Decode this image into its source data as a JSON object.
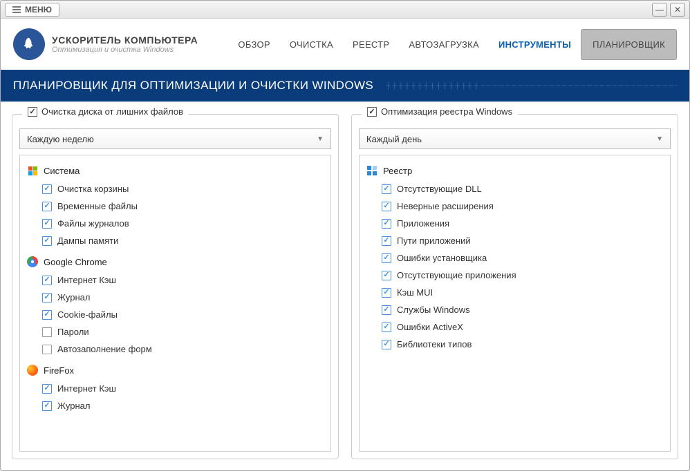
{
  "titlebar": {
    "menu": "МЕНЮ"
  },
  "header": {
    "logo_title": "УСКОРИТЕЛЬ КОМПЬЮТЕРА",
    "logo_sub": "Оптимизация и очистка Windows"
  },
  "nav": [
    {
      "label": "ОБЗОР"
    },
    {
      "label": "ОЧИСТКА"
    },
    {
      "label": "РЕЕСТР"
    },
    {
      "label": "АВТОЗАГРУЗКА"
    },
    {
      "label": "ИНСТРУМЕНТЫ"
    },
    {
      "label": "ПЛАНИРОВЩИК"
    }
  ],
  "banner": {
    "title": "ПЛАНИРОВЩИК ДЛЯ ОПТИМИЗАЦИИ И ОЧИСТКИ WINDOWS"
  },
  "panels": {
    "left": {
      "title": "Очистка диска от лишних файлов",
      "dropdown": "Каждую неделю",
      "groups": [
        {
          "icon": "windows",
          "title": "Система",
          "items": [
            {
              "label": "Очистка корзины",
              "checked": true
            },
            {
              "label": "Временные файлы",
              "checked": true
            },
            {
              "label": "Файлы журналов",
              "checked": true
            },
            {
              "label": "Дампы памяти",
              "checked": true
            }
          ]
        },
        {
          "icon": "chrome",
          "title": "Google Chrome",
          "items": [
            {
              "label": "Интернет Кэш",
              "checked": true
            },
            {
              "label": "Журнал",
              "checked": true
            },
            {
              "label": "Cookie-файлы",
              "checked": true
            },
            {
              "label": "Пароли",
              "checked": false
            },
            {
              "label": "Автозаполнение форм",
              "checked": false
            }
          ]
        },
        {
          "icon": "firefox",
          "title": "FireFox",
          "items": [
            {
              "label": "Интернет Кэш",
              "checked": true
            },
            {
              "label": "Журнал",
              "checked": true
            }
          ]
        }
      ]
    },
    "right": {
      "title": "Оптимизация реестра Windows",
      "dropdown": "Каждый день",
      "groups": [
        {
          "icon": "registry",
          "title": "Реестр",
          "items": [
            {
              "label": "Отсутствующие DLL",
              "checked": true
            },
            {
              "label": "Неверные расширения",
              "checked": true
            },
            {
              "label": "Приложения",
              "checked": true
            },
            {
              "label": "Пути приложений",
              "checked": true
            },
            {
              "label": "Ошибки установщика",
              "checked": true
            },
            {
              "label": "Отсутствующие приложения",
              "checked": true
            },
            {
              "label": "Кэш MUI",
              "checked": true
            },
            {
              "label": "Службы Windows",
              "checked": true
            },
            {
              "label": "Ошибки ActiveX",
              "checked": true
            },
            {
              "label": "Библиотеки типов",
              "checked": true
            }
          ]
        }
      ]
    }
  }
}
